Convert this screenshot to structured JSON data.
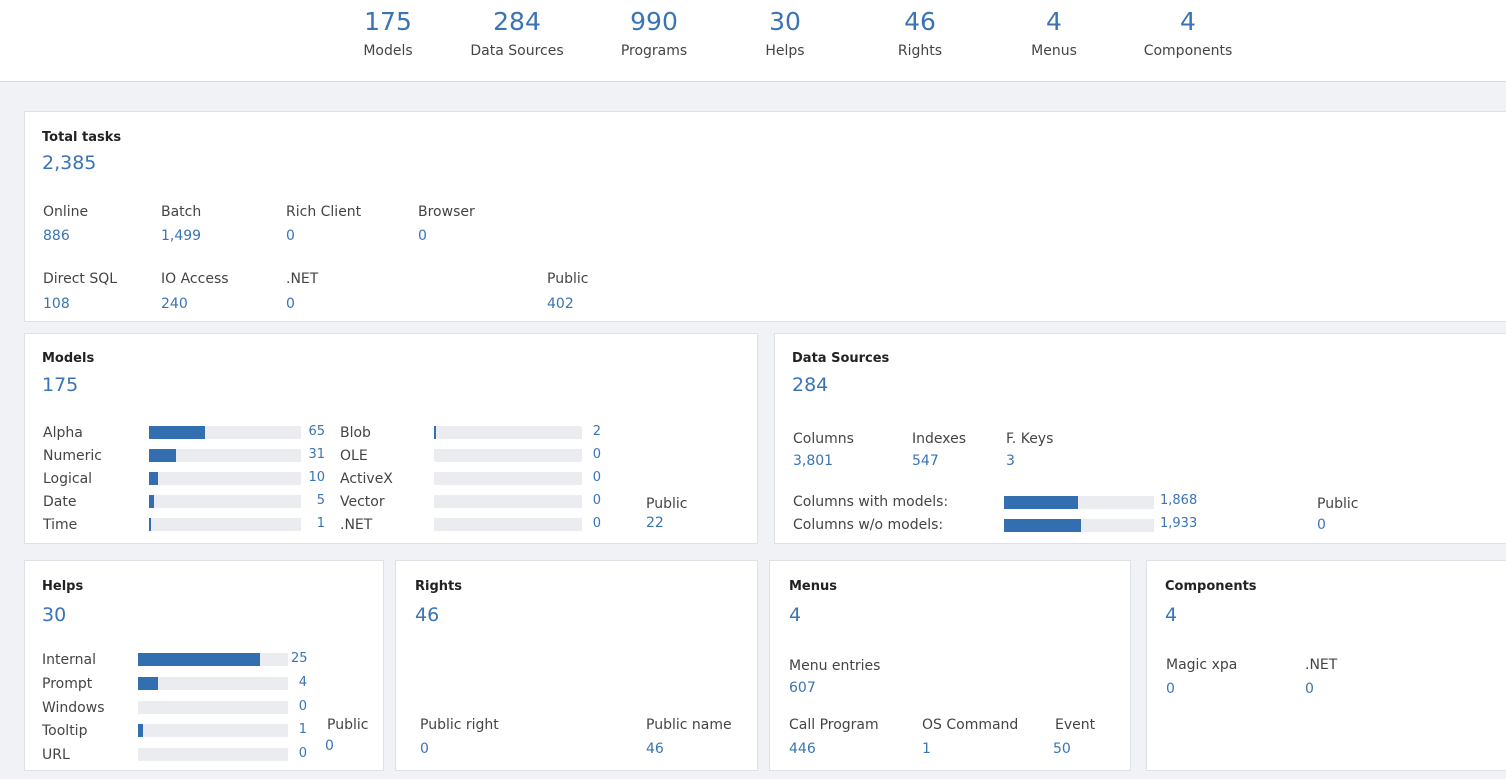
{
  "summary": [
    {
      "value": "175",
      "label": "Models"
    },
    {
      "value": "284",
      "label": "Data Sources"
    },
    {
      "value": "990",
      "label": "Programs"
    },
    {
      "value": "30",
      "label": "Helps"
    },
    {
      "value": "46",
      "label": "Rights"
    },
    {
      "value": "4",
      "label": "Menus"
    },
    {
      "value": "4",
      "label": "Components"
    }
  ],
  "total_tasks": {
    "title": "Total tasks",
    "total": "2,385",
    "stats": [
      {
        "label": "Online",
        "value": "886"
      },
      {
        "label": "Batch",
        "value": "1,499"
      },
      {
        "label": "Rich Client",
        "value": "0"
      },
      {
        "label": "Browser",
        "value": "0"
      },
      {
        "label": "Direct SQL",
        "value": "108"
      },
      {
        "label": "IO Access",
        "value": "240"
      },
      {
        "label": ".NET",
        "value": "0"
      },
      {
        "label": "Public",
        "value": "402"
      }
    ]
  },
  "models": {
    "title": "Models",
    "total": "175",
    "left_bars": [
      {
        "label": "Alpha",
        "value": "65",
        "fraction": 0.37
      },
      {
        "label": "Numeric",
        "value": "31",
        "fraction": 0.18
      },
      {
        "label": "Logical",
        "value": "10",
        "fraction": 0.06
      },
      {
        "label": "Date",
        "value": "5",
        "fraction": 0.03
      },
      {
        "label": "Time",
        "value": "1",
        "fraction": 0.01
      }
    ],
    "right_bars": [
      {
        "label": "Blob",
        "value": "2",
        "fraction": 0.01
      },
      {
        "label": "OLE",
        "value": "0",
        "fraction": 0
      },
      {
        "label": "ActiveX",
        "value": "0",
        "fraction": 0
      },
      {
        "label": "Vector",
        "value": "0",
        "fraction": 0
      },
      {
        "label": ".NET",
        "value": "0",
        "fraction": 0
      }
    ],
    "public_label": "Public",
    "public_value": "22"
  },
  "data_sources": {
    "title": "Data Sources",
    "total": "284",
    "stats": [
      {
        "label": "Columns",
        "value": "3,801"
      },
      {
        "label": "Indexes",
        "value": "547"
      },
      {
        "label": "F. Keys",
        "value": "3"
      }
    ],
    "bars": [
      {
        "label": "Columns with models:",
        "value": "1,868",
        "fraction": 0.49
      },
      {
        "label": "Columns w/o models:",
        "value": "1,933",
        "fraction": 0.51
      }
    ],
    "public_label": "Public",
    "public_value": "0"
  },
  "helps": {
    "title": "Helps",
    "total": "30",
    "bars": [
      {
        "label": "Internal",
        "value": "25",
        "fraction": 0.81
      },
      {
        "label": "Prompt",
        "value": "4",
        "fraction": 0.13
      },
      {
        "label": "Windows",
        "value": "0",
        "fraction": 0
      },
      {
        "label": "Tooltip",
        "value": "1",
        "fraction": 0.03
      },
      {
        "label": "URL",
        "value": "0",
        "fraction": 0
      }
    ],
    "public_label": "Public",
    "public_value": "0"
  },
  "rights": {
    "title": "Rights",
    "total": "46",
    "public_right_label": "Public right",
    "public_right_value": "0",
    "public_name_label": "Public name",
    "public_name_value": "46"
  },
  "menus": {
    "title": "Menus",
    "total": "4",
    "entries_label": "Menu entries",
    "entries_value": "607",
    "stats": [
      {
        "label": "Call Program",
        "value": "446"
      },
      {
        "label": "OS Command",
        "value": "1"
      },
      {
        "label": "Event",
        "value": "50"
      }
    ]
  },
  "components": {
    "title": "Components",
    "total": "4",
    "stats": [
      {
        "label": "Magic xpa",
        "value": "0"
      },
      {
        "label": ".NET",
        "value": "0"
      }
    ]
  }
}
